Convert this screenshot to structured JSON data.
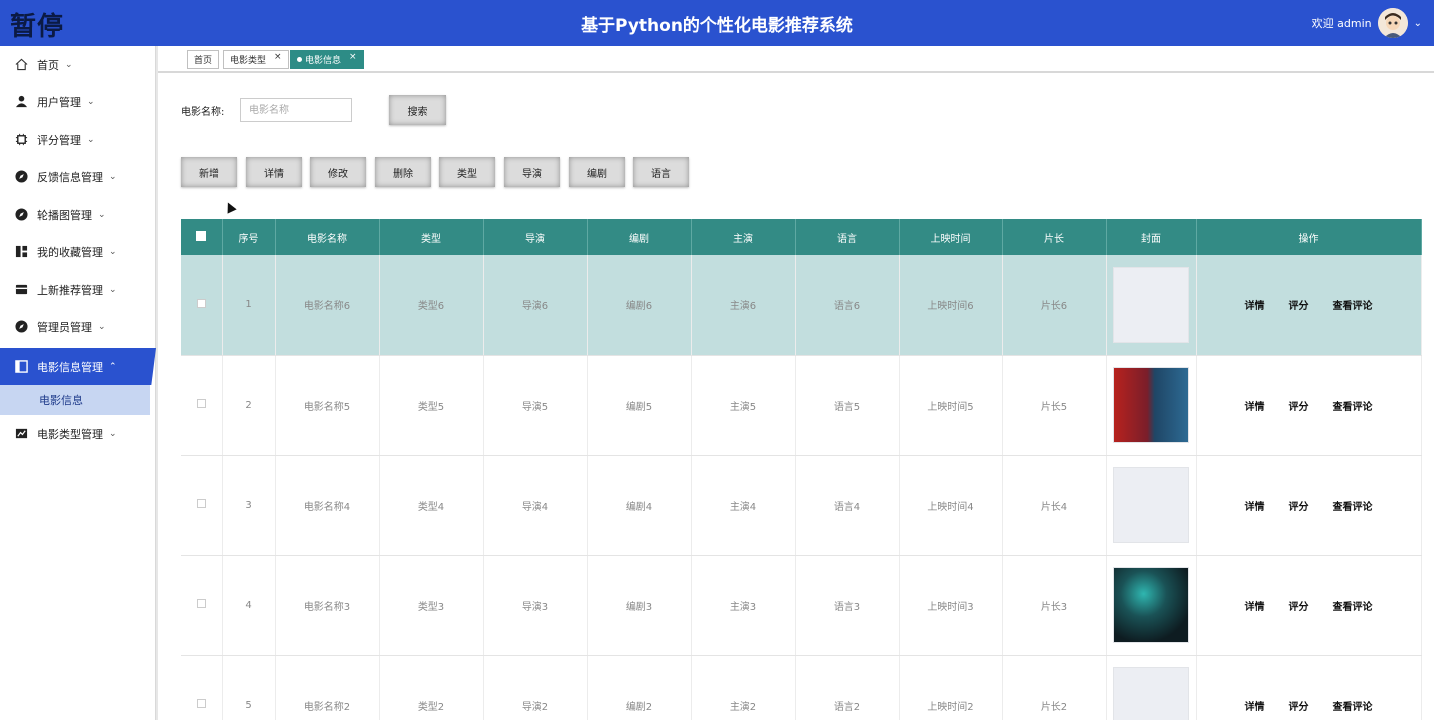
{
  "header": {
    "logo_text": "暂停",
    "title": "基于Python的个性化电影推荐系统",
    "welcome": "欢迎 admin",
    "brand_color": "#2a52cf"
  },
  "sidebar": {
    "items": [
      {
        "label": "首页",
        "icon": "home-icon"
      },
      {
        "label": "用户管理",
        "icon": "user-icon"
      },
      {
        "label": "评分管理",
        "icon": "chip-icon"
      },
      {
        "label": "反馈信息管理",
        "icon": "compass-icon"
      },
      {
        "label": "轮播图管理",
        "icon": "compass-icon"
      },
      {
        "label": "我的收藏管理",
        "icon": "grid-icon"
      },
      {
        "label": "上新推荐管理",
        "icon": "card-icon"
      },
      {
        "label": "管理员管理",
        "icon": "compass-icon"
      },
      {
        "label": "电影信息管理",
        "icon": "panel-icon"
      },
      {
        "label": "电影类型管理",
        "icon": "chart-icon"
      }
    ],
    "active_sub": "电影信息"
  },
  "tabs": [
    {
      "label": "首页"
    },
    {
      "label": "电影类型",
      "close": "×"
    },
    {
      "label": "电影信息",
      "close": "×"
    }
  ],
  "search": {
    "label": "电影名称:",
    "placeholder": "电影名称",
    "button": "搜索"
  },
  "actions": [
    "新增",
    "详情",
    "修改",
    "删除",
    "类型",
    "导演",
    "编剧",
    "语言"
  ],
  "table": {
    "headers": [
      "序号",
      "电影名称",
      "类型",
      "导演",
      "编剧",
      "主演",
      "语言",
      "上映时间",
      "片长",
      "封面",
      "操作"
    ],
    "rows": [
      {
        "no": "1",
        "name": "电影名称6",
        "type": "类型6",
        "director": "导演6",
        "writer": "编剧6",
        "actor": "主演6",
        "lang": "语言6",
        "date": "上映时间6",
        "length": "片长6"
      },
      {
        "no": "2",
        "name": "电影名称5",
        "type": "类型5",
        "director": "导演5",
        "writer": "编剧5",
        "actor": "主演5",
        "lang": "语言5",
        "date": "上映时间5",
        "length": "片长5"
      },
      {
        "no": "3",
        "name": "电影名称4",
        "type": "类型4",
        "director": "导演4",
        "writer": "编剧4",
        "actor": "主演4",
        "lang": "语言4",
        "date": "上映时间4",
        "length": "片长4"
      },
      {
        "no": "4",
        "name": "电影名称3",
        "type": "类型3",
        "director": "导演3",
        "writer": "编剧3",
        "actor": "主演3",
        "lang": "语言3",
        "date": "上映时间3",
        "length": "片长3"
      },
      {
        "no": "5",
        "name": "电影名称2",
        "type": "类型2",
        "director": "导演2",
        "writer": "编剧2",
        "actor": "主演2",
        "lang": "语言2",
        "date": "上映时间2",
        "length": "片长2"
      }
    ],
    "ops": [
      "详情",
      "评分",
      "查看评论"
    ]
  }
}
